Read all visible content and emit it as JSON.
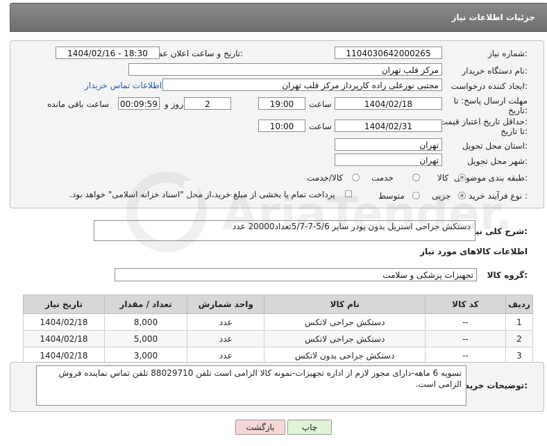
{
  "header": {
    "title": "جزئیات اطلاعات نیاز"
  },
  "form": {
    "need_number_label": "شماره نیاز:",
    "need_number": "1104030642000265",
    "announce_label": "تاریخ و ساعت اعلان عمومی:",
    "announce_value": "1404/02/16 - 18:30",
    "buyer_label": "نام دستگاه خریدار:",
    "buyer_value": "مرکز قلب تهران",
    "creator_label": "ایجاد کننده درخواست:",
    "creator_value": "مجتبی نورعلی زاده کارپرداز مرکز قلب تهران",
    "contact_link": "اطلاعات تماس خریدار",
    "deadline_label_1": "مهلت ارسال پاسخ: تا",
    "deadline_label_2": "تاریخ:",
    "deadline_date": "1404/02/18",
    "time_label": "ساعت",
    "deadline_time": "19:00",
    "days_value": "2",
    "days_label": "روز و",
    "remaining_time": "00:09:59",
    "remaining_label": "ساعت باقی مانده",
    "price_label_1": "حداقل تاریخ اعتبار قیمت:",
    "price_label_2": "تا تاریخ:",
    "price_date": "1404/02/31",
    "price_time": "10:00",
    "province_label": "استان محل تحویل:",
    "province_value": "تهران",
    "city_label": "شهر محل تحویل:",
    "city_value": "تهران",
    "category_label": "طبقه بندی موضوعی:",
    "category_options": [
      "کالا",
      "خدمت",
      "کالا/خدمت"
    ],
    "process_label": "نوع فرآیند خرید :",
    "process_options": [
      "جزیی",
      "متوسط"
    ],
    "payment_note": "پرداخت تمام یا بخشی از مبلغ خرید،از محل \"اسناد خزانه اسلامی\" خواهد بود."
  },
  "description": {
    "label": "شرح کلی نیاز:",
    "value": "دستکش جراحی استریل بدون پودر سایز 5/6-7-5/7تعداد20000 عدد"
  },
  "goods": {
    "section_title": "اطلاعات کالاهای مورد نیاز",
    "group_label": "گروه کالا:",
    "group_value": "تجهیزات پزشکی و سلامت",
    "columns": [
      "ردیف",
      "کد کالا",
      "نام کالا",
      "واحد شمارش",
      "تعداد / مقدار",
      "تاریخ نیاز"
    ],
    "rows": [
      [
        "1",
        "--",
        "دستکش جراحی لاتکس",
        "عدد",
        "8,000",
        "1404/02/18"
      ],
      [
        "2",
        "--",
        "دستکش جراحی لاتکس",
        "عدد",
        "5,000",
        "1404/02/18"
      ],
      [
        "3",
        "--",
        "دستکش جراحی بدون لاتکس",
        "عدد",
        "3,000",
        "1404/02/18"
      ]
    ]
  },
  "buyer_notes": {
    "label": "توضیحات خریدار:",
    "value": "تسویه 6 ماهه-دارای مجوز لازم از اداره تجهیزات-نمونه کالا الزامی است تلفن 88029710 تلفن تماس نماینده فروش الزامی است."
  },
  "buttons": {
    "print": "چاپ",
    "back": "بازگشت"
  },
  "watermark": {
    "text": "AriaTender.net"
  },
  "colors": {
    "header_bg": "#7a7a7a",
    "link": "#1b5cb8",
    "back_button_bg": "#f6d6d6",
    "print_button_bg": "#dff3d6"
  }
}
